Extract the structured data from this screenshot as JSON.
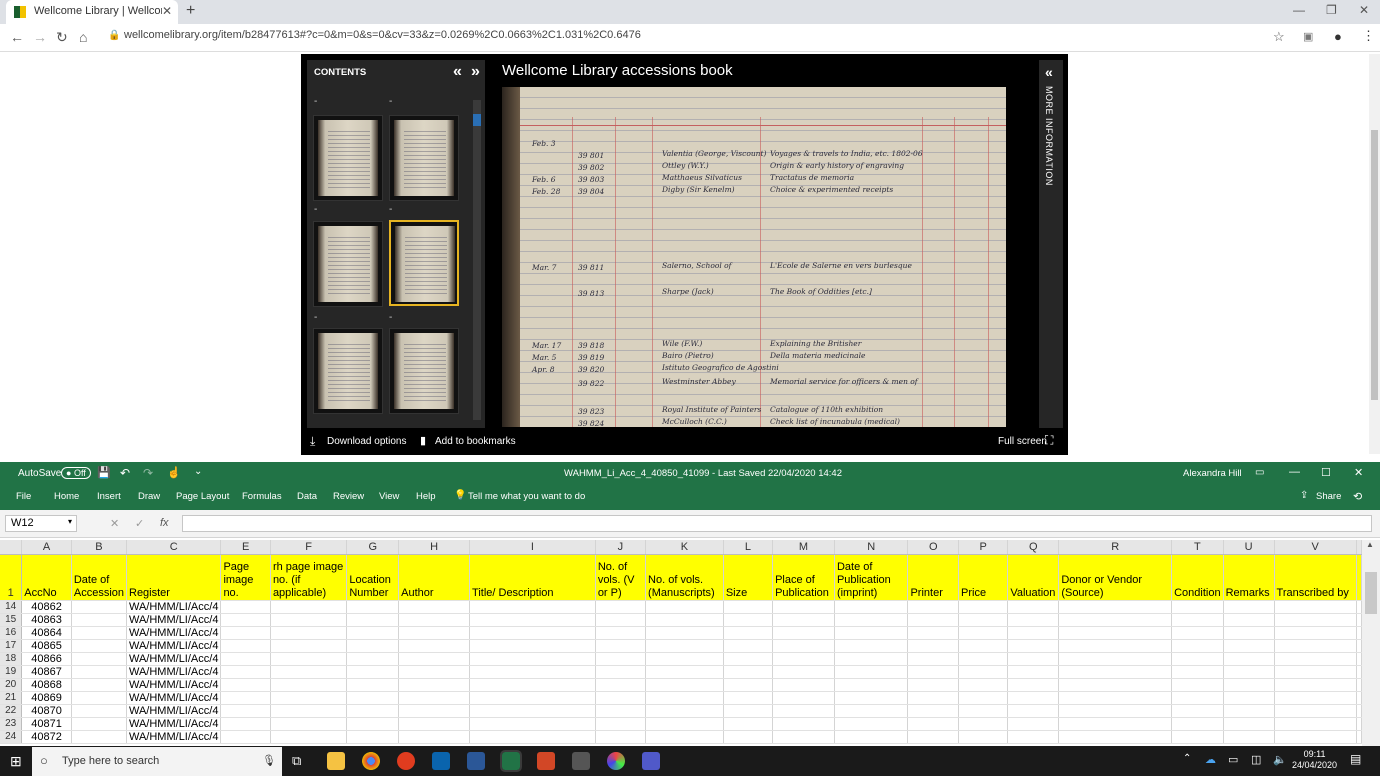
{
  "browser": {
    "tab_title": "Wellcome Library | Wellcome Libr",
    "url": "wellcomelibrary.org/item/b28477613#?c=0&m=0&s=0&cv=33&z=0.0269%2C0.0663%2C1.031%2C0.6476"
  },
  "viewer": {
    "contents_label": "CONTENTS",
    "title": "Wellcome Library accessions book",
    "more_info": "MORE INFORMATION",
    "download": "Download options",
    "bookmarks": "Add to bookmarks",
    "fullscreen": "Full screen"
  },
  "excel": {
    "autosave": "AutoSave",
    "autosave_state": "Off",
    "doc_title": "WAHMM_Li_Acc_4_40850_41099  -  Last Saved 22/04/2020 14:42",
    "user": "Alexandra Hill",
    "menu": [
      "File",
      "Home",
      "Insert",
      "Draw",
      "Page Layout",
      "Formulas",
      "Data",
      "Review",
      "View",
      "Help"
    ],
    "tell_me": "Tell me what you want to do",
    "share": "Share",
    "name_box": "W12",
    "columns": [
      "A",
      "B",
      "C",
      "E",
      "F",
      "G",
      "H",
      "I",
      "J",
      "K",
      "L",
      "M",
      "N",
      "O",
      "P",
      "Q",
      "R",
      "T",
      "U",
      "V"
    ],
    "headers": [
      "AccNo",
      "Date of Accession",
      "Register",
      "Page image no.",
      "rh page image no. (if applicable)",
      "Location Number",
      "Author",
      "Title/ Description",
      "No. of vols. (V or P)",
      "No. of vols. (Manuscripts)",
      "Size",
      "Place of Publication",
      "Date of Publication (imprint)",
      "Printer",
      "Price",
      "Valuation",
      "Donor or Vendor (Source)",
      "Condition",
      "Remarks",
      "Transcribed by"
    ],
    "rows": [
      {
        "n": "14",
        "acc": "40862",
        "reg": "WA/HMM/LI/Acc/4"
      },
      {
        "n": "15",
        "acc": "40863",
        "reg": "WA/HMM/LI/Acc/4"
      },
      {
        "n": "16",
        "acc": "40864",
        "reg": "WA/HMM/LI/Acc/4"
      },
      {
        "n": "17",
        "acc": "40865",
        "reg": "WA/HMM/LI/Acc/4"
      },
      {
        "n": "18",
        "acc": "40866",
        "reg": "WA/HMM/LI/Acc/4"
      },
      {
        "n": "19",
        "acc": "40867",
        "reg": "WA/HMM/LI/Acc/4"
      },
      {
        "n": "20",
        "acc": "40868",
        "reg": "WA/HMM/LI/Acc/4"
      },
      {
        "n": "21",
        "acc": "40869",
        "reg": "WA/HMM/LI/Acc/4"
      },
      {
        "n": "22",
        "acc": "40870",
        "reg": "WA/HMM/LI/Acc/4"
      },
      {
        "n": "23",
        "acc": "40871",
        "reg": "WA/HMM/LI/Acc/4"
      },
      {
        "n": "24",
        "acc": "40872",
        "reg": "WA/HMM/LI/Acc/4"
      }
    ]
  },
  "taskbar": {
    "search_placeholder": "Type here to search",
    "time": "09:11",
    "date": "24/04/2020"
  }
}
